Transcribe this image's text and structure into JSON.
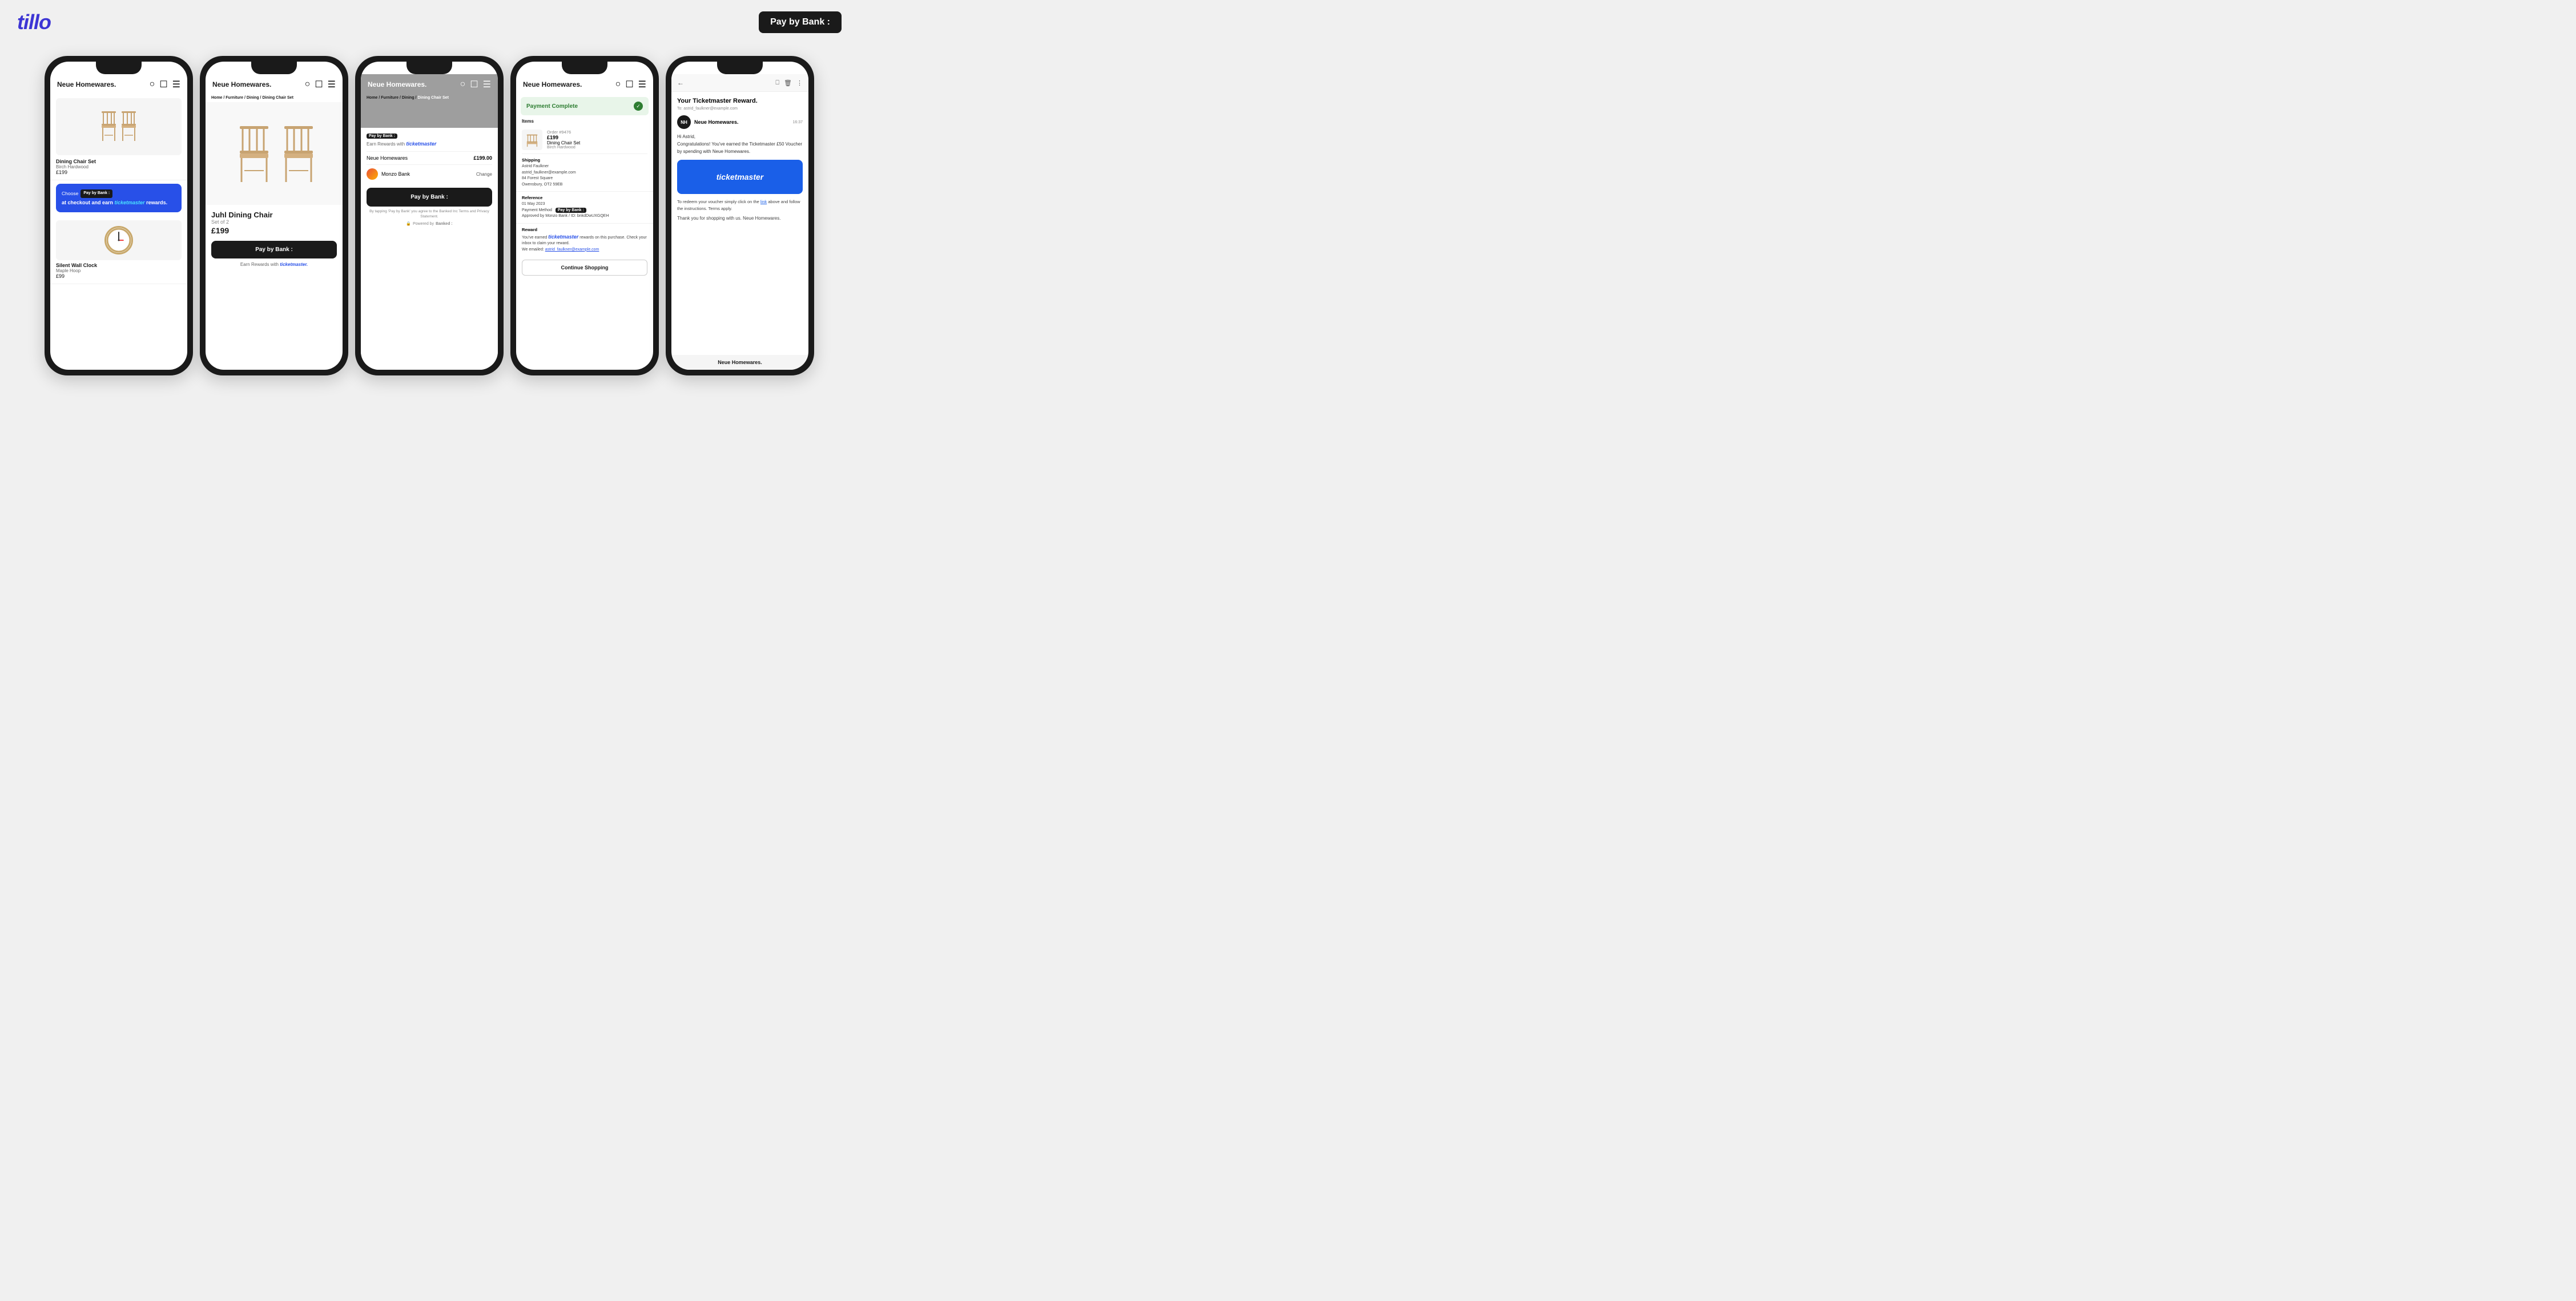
{
  "header": {
    "logo": "tillo",
    "pay_by_bank_badge": "Pay by Bank :"
  },
  "phone1": {
    "brand": "Neue Homewares.",
    "product1": {
      "name": "Dining Chair Set",
      "sub": "Birch Hardwood",
      "price": "£199"
    },
    "banner": {
      "prefix": "Choose",
      "badge": "Pay by Bank :",
      "text1": "at checkout and earn",
      "brand": "ticketmaster",
      "text2": "rewards."
    },
    "product2": {
      "name": "Silent Wall Clock",
      "sub": "Maple Hoop",
      "price": "£99"
    }
  },
  "phone2": {
    "brand": "Neue Homewares.",
    "breadcrumb": "Home / Furniture / Dining /",
    "breadcrumb_active": "Dining Chair Set",
    "product": {
      "name": "Juhl Dining Chair",
      "sub": "Set of 2",
      "price": "£199",
      "pay_btn": "Pay by Bank :",
      "earn_text": "Earn Rewards with",
      "earn_brand": "ticketmaster."
    }
  },
  "phone3": {
    "brand": "Neue Homewares.",
    "breadcrumb": "Home / Furniture / Dining /",
    "breadcrumb_active": "Dining Chair Set",
    "payment": {
      "title": "Pay by Bank :",
      "earn_text": "Earn Rewards with",
      "earn_brand": "ticketmaster",
      "merchant": "Neue Homewares",
      "amount": "£199.00",
      "bank": "Monzo Bank",
      "change": "Change",
      "pay_btn": "Pay by Bank :",
      "terms": "By tapping 'Pay by Bank' you agree to the Banked Inc Terms and Privacy Statement.",
      "powered": "Powered by",
      "powered_brand": "Banked :"
    }
  },
  "phone4": {
    "brand": "Neue Homewares.",
    "payment_complete": "Payment Complete",
    "items_label": "Items",
    "order": {
      "number": "Order #9476",
      "price": "£199",
      "name": "Dining Chair Set",
      "sub": "Birch Hardwood"
    },
    "shipping": {
      "label": "Shipping",
      "name": "Astrid Faulkner",
      "email": "astrid_faulkner@example.com",
      "address": "84 Forest Square",
      "city": "Owensbury, OT2 59EB"
    },
    "reference": {
      "label": "Reference",
      "date": "01 May 2023",
      "method_label": "Payment Method",
      "method": "Pay by Bank :",
      "approved": "Approved by Monzo Bank / ID: bnkdDwUXGQEH"
    },
    "reward": {
      "label": "Reward",
      "text": "You've earned",
      "brand": "ticketmaster",
      "text2": "rewards on this purchase. Check your inbox to claim your reward.",
      "emailed": "We emailed:",
      "email": "astrid_faulkner@example.com"
    },
    "continue_btn": "Continue Shopping"
  },
  "phone5": {
    "email": {
      "title": "Your Ticketmaster Reward.",
      "to": "To: astrid_faulkner@example.com",
      "sender_initials": "NH",
      "sender_name": "Neue Homewares.",
      "send_time": "16:37",
      "greeting": "Hi Astrid,",
      "body1": "Congratulations! You've earned the Ticketmaster £50 Voucher by spending with Neue Homewares.",
      "ticketmaster_logo": "ticketmaster",
      "footer1": "To redeem your voucher simply click on the",
      "footer_link": "link",
      "footer2": "above and follow the instructions. Terms apply.",
      "sign": "Thank you for shopping with us. Neue Homewares.",
      "footer_brand": "Neue Homewares."
    }
  }
}
